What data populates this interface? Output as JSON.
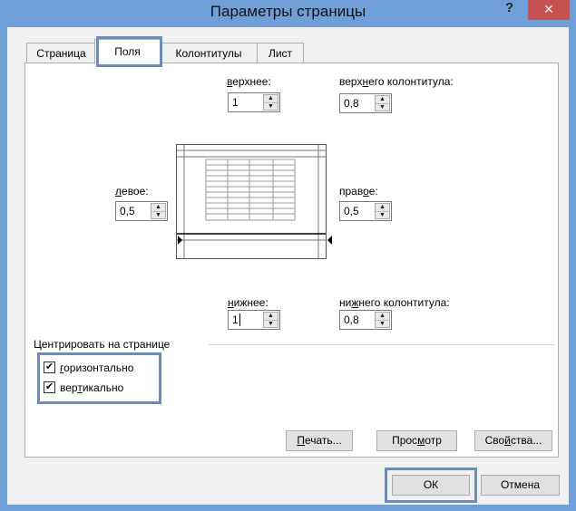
{
  "window": {
    "title": "Параметры страницы",
    "help_label": "?",
    "close_label": "✕"
  },
  "tabs": [
    {
      "label": "Страница"
    },
    {
      "label": "Поля"
    },
    {
      "label": "Колонтитулы"
    },
    {
      "label": "Лист"
    }
  ],
  "margins": {
    "top": {
      "label_pre": "",
      "label_ul": "в",
      "label_post": "ерхнее:",
      "value": "1"
    },
    "header": {
      "label_pre": "верх",
      "label_ul": "н",
      "label_post": "его колонтитула:",
      "value": "0,8"
    },
    "left": {
      "label_pre": "",
      "label_ul": "л",
      "label_post": "евое:",
      "value": "0,5"
    },
    "right": {
      "label_pre": "прав",
      "label_ul": "о",
      "label_post": "е:",
      "value": "0,5"
    },
    "bottom": {
      "label_pre": "",
      "label_ul": "н",
      "label_post": "ижнее:",
      "value": "1"
    },
    "footer": {
      "label_pre": "ни",
      "label_ul": "ж",
      "label_post": "него колонтитула:",
      "value": "0,8"
    }
  },
  "center": {
    "group_label": "Центрировать на странице",
    "horizontal": {
      "label_pre": "",
      "label_ul": "г",
      "label_post": "оризонтально",
      "checked": true
    },
    "vertical": {
      "label_pre": "вер",
      "label_ul": "т",
      "label_post": "икально",
      "checked": true
    }
  },
  "buttons": {
    "print": {
      "pre": "",
      "ul": "П",
      "post": "ечать..."
    },
    "preview": {
      "pre": "Прос",
      "ul": "м",
      "post": "отр"
    },
    "properties": {
      "pre": "Сво",
      "ul": "й",
      "post": "ства..."
    },
    "ok": "ОК",
    "cancel": "Отмена"
  },
  "check_mark": "✔",
  "spin_up": "▲",
  "spin_down": "▼",
  "colors": {
    "title_bar": "#6f9fd8",
    "close_button": "#c75050",
    "highlight": "#6b8cbd"
  }
}
